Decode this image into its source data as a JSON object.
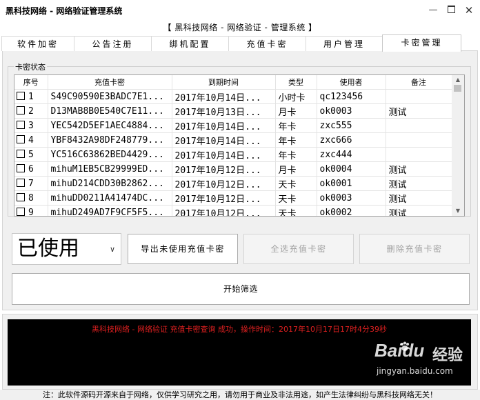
{
  "window": {
    "title": "黑科技网络 - 网络验证管理系统",
    "subtitle": "【 黑科技网络 - 网络验证 - 管理系统 】"
  },
  "tabs": [
    {
      "label": "软件加密"
    },
    {
      "label": "公告注册"
    },
    {
      "label": "绑机配置"
    },
    {
      "label": "充值卡密"
    },
    {
      "label": "用户管理"
    },
    {
      "label": "卡密管理"
    }
  ],
  "group_caption": "卡密状态",
  "table": {
    "headers": [
      "序号",
      "充值卡密",
      "到期时间",
      "类型",
      "使用者",
      "备注"
    ],
    "rows": [
      {
        "no": "1",
        "card": "S49C90590E3BADC7E1...",
        "expire": "2017年10月14日...",
        "type": "小时卡",
        "user": "qc123456",
        "note": ""
      },
      {
        "no": "2",
        "card": "D13MAB8B0E540C7E11...",
        "expire": "2017年10月13日...",
        "type": "月卡",
        "user": "ok0003",
        "note": "测试"
      },
      {
        "no": "3",
        "card": "YEC542D5EF1AEC4884...",
        "expire": "2017年10月14日...",
        "type": "年卡",
        "user": "zxc555",
        "note": ""
      },
      {
        "no": "4",
        "card": "YBF8432A98DF248779...",
        "expire": "2017年10月14日...",
        "type": "年卡",
        "user": "zxc666",
        "note": ""
      },
      {
        "no": "5",
        "card": "YC516C63862BED4429...",
        "expire": "2017年10月14日...",
        "type": "年卡",
        "user": "zxc444",
        "note": ""
      },
      {
        "no": "6",
        "card": "mihuM1EB5CB29999ED...",
        "expire": "2017年10月12日...",
        "type": "月卡",
        "user": "ok0004",
        "note": "测试"
      },
      {
        "no": "7",
        "card": "mihuD214CDD30B2862...",
        "expire": "2017年10月12日...",
        "type": "天卡",
        "user": "ok0001",
        "note": "测试"
      },
      {
        "no": "8",
        "card": "mihuDD0211A41474DC...",
        "expire": "2017年10月12日...",
        "type": "天卡",
        "user": "ok0003",
        "note": "测试"
      },
      {
        "no": "9",
        "card": "mihuD249AD7F9CF5F5...",
        "expire": "2017年10月12日...",
        "type": "天卡",
        "user": "ok0002",
        "note": "测试"
      }
    ]
  },
  "controls": {
    "status_select_value": "已使用",
    "export_label": "导出未使用充值卡密",
    "select_all_label": "全选充值卡密",
    "delete_label": "删除充值卡密",
    "filter_label": "开始筛选"
  },
  "log": {
    "message": "黑科技网络 - 网络验证 充值卡密查询 成功，操作时间：2017年10月17日17时4分39秒",
    "text_color": "#e02020"
  },
  "watermark": {
    "brand": "Baidu",
    "brand_cn": "经验",
    "url": "jingyan.baidu.com"
  },
  "footer": "注：此软件源码开源来自于网络，仅供学习研究之用，请勿用于商业及非法用途，如产生法律纠纷与黑科技网络无关！"
}
